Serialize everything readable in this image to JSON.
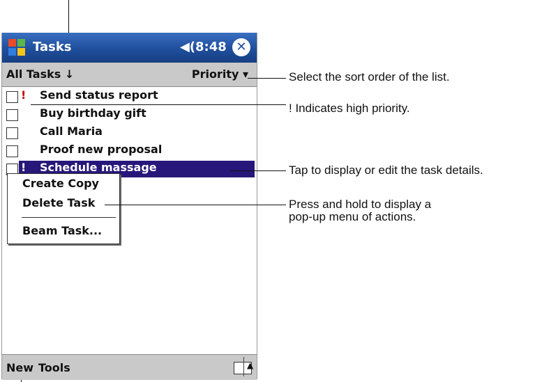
{
  "window": {
    "title": "Tasks",
    "time": "8:48",
    "volume_icon": "speaker-icon",
    "close_icon": "close-icon"
  },
  "toolbar": {
    "left_label": "All Tasks",
    "right_label": "Priority"
  },
  "tasks": [
    {
      "name": "Send status report",
      "priority_mark": "!",
      "selected": false
    },
    {
      "name": "Buy birthday gift",
      "priority_mark": "",
      "selected": false
    },
    {
      "name": "Call Maria",
      "priority_mark": "",
      "selected": false
    },
    {
      "name": "Proof new proposal",
      "priority_mark": "",
      "selected": false
    },
    {
      "name": "Schedule massage",
      "priority_mark": "!",
      "selected": true
    }
  ],
  "context_menu": {
    "items": [
      "Create Copy",
      "Delete Task",
      "Beam Task..."
    ]
  },
  "menubar": {
    "new_label": "New",
    "tools_label": "Tools"
  },
  "annotations": {
    "sort": "Select the sort order of the list.",
    "priority": "! Indicates high priority.",
    "tap": "Tap to display or edit the task details.",
    "hold_line1": "Press and hold to display a",
    "hold_line2": "pop-up menu of actions."
  },
  "colors": {
    "titlebar": "#1f4e9c",
    "selection": "#27177a",
    "priority": "#c00000",
    "bars": "#c9c9c9"
  }
}
